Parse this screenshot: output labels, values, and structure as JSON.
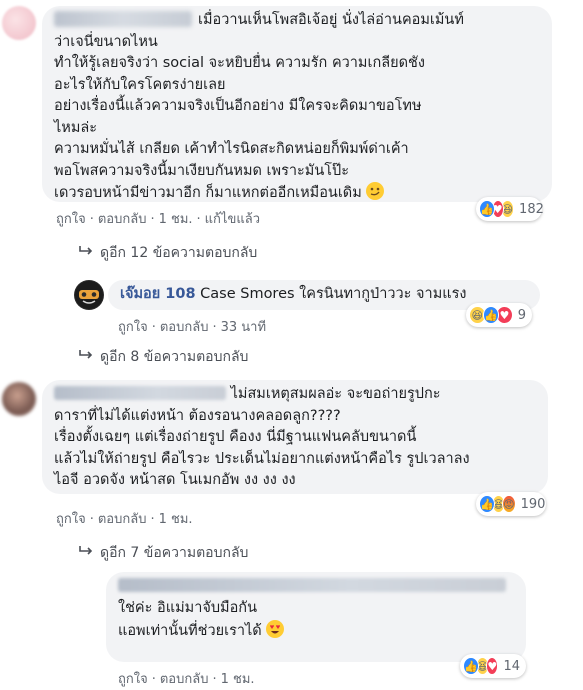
{
  "comments": [
    {
      "name_visible": "",
      "lines": [
        "เมื่อวานเห็นโพสอิเจ้อยู่ นั่งไล่อ่านคอมเม้นท์",
        "ว่าเจนี่ขนาดไหน",
        "ทำให้รู้เลยจริงว่า social จะหยิบยื่น ความรัก ความเกลียดชัง",
        "อะไรให้กับใครโคตรง่ายเลย",
        "อย่างเรื่องนี้แล้วความจริงเป็นอีกอย่าง มีใครจะคิดมาขอโทษ",
        "ไหมล่ะ",
        "ความหมั่นไส้ เกลียด เค้าทำไรนิดสะกิดหน่อยก็พิมพ์ด่าเค้า",
        "พอโพสความจริงนี้มาเงียบกันหมด เพราะมันโป๊ะ",
        "เดวรอบหน้ามีข่าวมาอีก ก็มาแหกต่ออีกเหมือนเดิม"
      ],
      "meta": {
        "like": "ถูกใจ",
        "reply": "ตอบกลับ",
        "time": "1 ชม.",
        "edited": "แก้ไขแล้ว"
      },
      "reaction_count": "182",
      "reactions": [
        "like",
        "love",
        "haha"
      ]
    },
    {
      "name": "เจ๊มอย 108",
      "text": "Case Smores ใครนินทากูป่าววะ จามแรง",
      "meta": {
        "like": "ถูกใจ",
        "reply": "ตอบกลับ",
        "time": "33 นาที"
      },
      "reaction_count": "9",
      "reactions": [
        "haha",
        "like",
        "love"
      ]
    },
    {
      "name_visible": "",
      "lines": [
        "ไม่สมเหตุสมผลอ่ะ จะขอถ่ายรูปกะ",
        "ดาราที่ไม่ได้แต่งหน้า ต้องรอนางคลอดลูก????",
        "เรื่องตั้งเฉยๆ แต่เรื่องถ่ายรูป คืองง นี่มีฐานแฟนคลับขนาดนี้",
        "แล้วไม่ให้ถ่ายรูป คือไรวะ ประเด็นไม่อยากแต่งหน้าคือไร รูปเวลาลง",
        "ไอจี อวดจัง หน้าสด โนเมกอัพ งง งง งง"
      ],
      "meta": {
        "like": "ถูกใจ",
        "reply": "ตอบกลับ",
        "time": "1 ชม."
      },
      "reaction_count": "190",
      "reactions": [
        "like",
        "haha",
        "angry"
      ]
    },
    {
      "name_visible": "",
      "lines": [
        "ใช่ค่ะ อิแม่มาจับมือกัน",
        "แอพเท่านั้นที่ช่วยเราได้"
      ],
      "meta": {
        "like": "ถูกใจ",
        "reply": "ตอบกลับ",
        "time": "1 ชม."
      },
      "reaction_count": "14",
      "reactions": [
        "like",
        "haha",
        "love"
      ]
    }
  ],
  "view_more": [
    "ดูอีก 12 ข้อความตอบกลับ",
    "ดูอีก 8 ข้อความตอบกลับ",
    "ดูอีก 7 ข้อความตอบกลับ"
  ]
}
